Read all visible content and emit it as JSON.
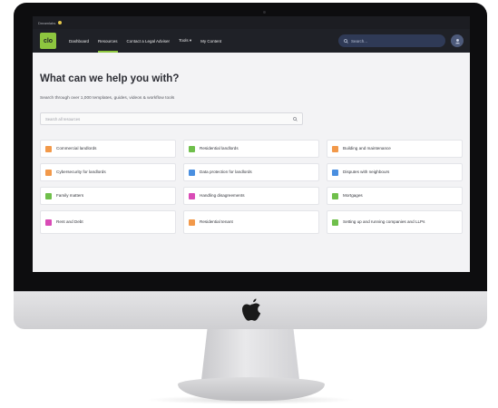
{
  "browser": {
    "tab_title": "Dreamlabs"
  },
  "topnav": {
    "logo_text": "clo",
    "items": [
      {
        "label": "Dashboard",
        "active": false
      },
      {
        "label": "Resources",
        "active": true
      },
      {
        "label": "Contact a Legal Adviser",
        "active": false
      },
      {
        "label": "Tools ▾",
        "active": false
      },
      {
        "label": "My Content",
        "active": false
      }
    ],
    "search_placeholder": "Search..."
  },
  "main": {
    "title": "What can we help you with?",
    "subtitle": "Search through over 1,000 templates, guides, videos & workflow tools",
    "search_placeholder": "Search all resources"
  },
  "categories": [
    {
      "label": "Commercial landlords",
      "icon": "building-icon",
      "color": "#f2994a"
    },
    {
      "label": "Residential landlords",
      "icon": "house-icon",
      "color": "#6fbf4b"
    },
    {
      "label": "Building and maintenance",
      "icon": "tools-icon",
      "color": "#f2994a"
    },
    {
      "label": "Cybersecurity for landlords",
      "icon": "tag-icon",
      "color": "#f2994a"
    },
    {
      "label": "Data protection for landlords",
      "icon": "document-icon",
      "color": "#4a8fe0"
    },
    {
      "label": "Disputes with neighbours",
      "icon": "people-icon",
      "color": "#4a8fe0"
    },
    {
      "label": "Family matters",
      "icon": "calendar-icon",
      "color": "#6fbf4b"
    },
    {
      "label": "Handling disagreements",
      "icon": "chat-icon",
      "color": "#d94bb6"
    },
    {
      "label": "Mortgages",
      "icon": "house-icon",
      "color": "#6fbf4b"
    },
    {
      "label": "Rent and Debt",
      "icon": "receipt-icon",
      "color": "#d94bb6"
    },
    {
      "label": "Residential tenant",
      "icon": "sofa-icon",
      "color": "#f2994a"
    },
    {
      "label": "Setting up and running companies and LLPs",
      "icon": "leaf-icon",
      "color": "#6fbf4b"
    }
  ]
}
